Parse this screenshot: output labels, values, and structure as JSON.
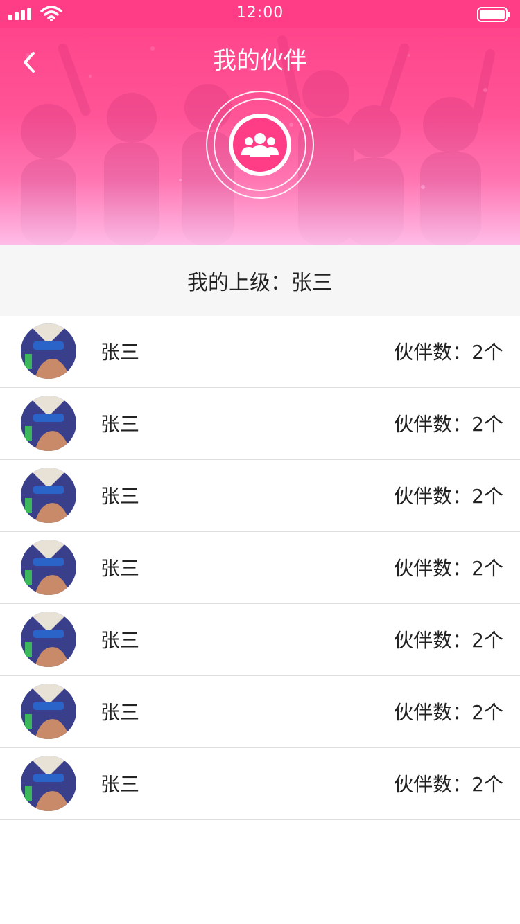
{
  "status_bar": {
    "time": "12:00"
  },
  "header": {
    "title": "我的伙伴",
    "back_icon": "chevron-left-icon",
    "badge_icon": "group-icon"
  },
  "superior": {
    "label": "我的上级：",
    "name": "张三"
  },
  "partners": [
    {
      "name": "张三",
      "count_label": "伙伴数：",
      "count": "2个"
    },
    {
      "name": "张三",
      "count_label": "伙伴数：",
      "count": "2个"
    },
    {
      "name": "张三",
      "count_label": "伙伴数：",
      "count": "2个"
    },
    {
      "name": "张三",
      "count_label": "伙伴数：",
      "count": "2个"
    },
    {
      "name": "张三",
      "count_label": "伙伴数：",
      "count": "2个"
    },
    {
      "name": "张三",
      "count_label": "伙伴数：",
      "count": "2个"
    },
    {
      "name": "张三",
      "count_label": "伙伴数：",
      "count": "2个"
    }
  ],
  "colors": {
    "accent": "#ff3c86",
    "list_bg": "#f6f6f6",
    "divider": "#dedede"
  }
}
